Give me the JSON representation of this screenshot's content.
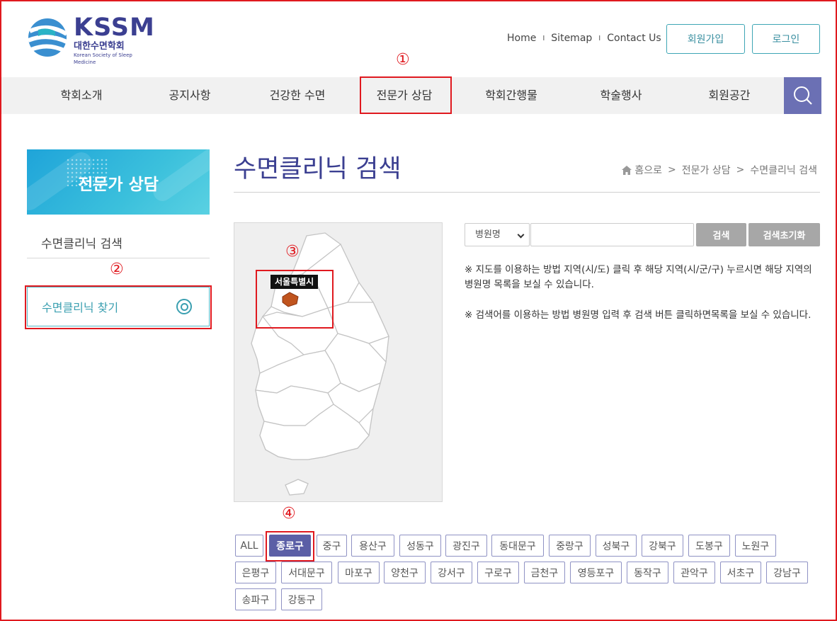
{
  "logo": {
    "title": "KSSM",
    "korean_name": "대한수면학회",
    "english_name": "Korean Society of Sleep Medicine"
  },
  "top_links": [
    "Home",
    "Sitemap",
    "Contact Us"
  ],
  "auth": {
    "signup": "회원가입",
    "login": "로그인"
  },
  "nav": {
    "items": [
      "학회소개",
      "공지사항",
      "건강한 수면",
      "전문가 상담",
      "학회간행물",
      "학술행사",
      "회원공간"
    ],
    "active_index": 3
  },
  "annotations": [
    "①",
    "②",
    "③",
    "④"
  ],
  "sidebar": {
    "banner_title": "전문가 상담",
    "items": [
      {
        "label": "수면클리닉 검색"
      },
      {
        "label": "수면클리닉 찾기"
      }
    ]
  },
  "page": {
    "title": "수면클리닉 검색",
    "breadcrumb": [
      "홈으로",
      "전문가 상담",
      "수면클리닉 검색"
    ]
  },
  "map": {
    "tooltip": "서울특별시"
  },
  "search": {
    "select_value": "병원명",
    "input_value": "",
    "search_button": "검색",
    "reset_button": "검색초기화"
  },
  "descriptions": [
    "※ 지도를 이용하는 방법 지역(시/도) 클릭 후 해당 지역(시/군/구) 누르시면 해당 지역의 병원명 목록을 보실 수 있습니다.",
    "※ 검색어를 이용하는 방법 병원명 입력 후 검색 버튼 클릭하면목록을 보실 수 있습니다."
  ],
  "districts": {
    "items": [
      "ALL",
      "종로구",
      "중구",
      "용산구",
      "성동구",
      "광진구",
      "동대문구",
      "중랑구",
      "성북구",
      "강북구",
      "도봉구",
      "노원구",
      "은평구",
      "서대문구",
      "마포구",
      "양천구",
      "강서구",
      "구로구",
      "금천구",
      "영등포구",
      "동작구",
      "관악구",
      "서초구",
      "강남구",
      "송파구",
      "강동구"
    ],
    "active": "종로구"
  },
  "colors": {
    "brand": "#3b3f91",
    "accent": "#3ea6b5",
    "nav_search": "#6b70b4",
    "annotation": "#e0191f"
  }
}
